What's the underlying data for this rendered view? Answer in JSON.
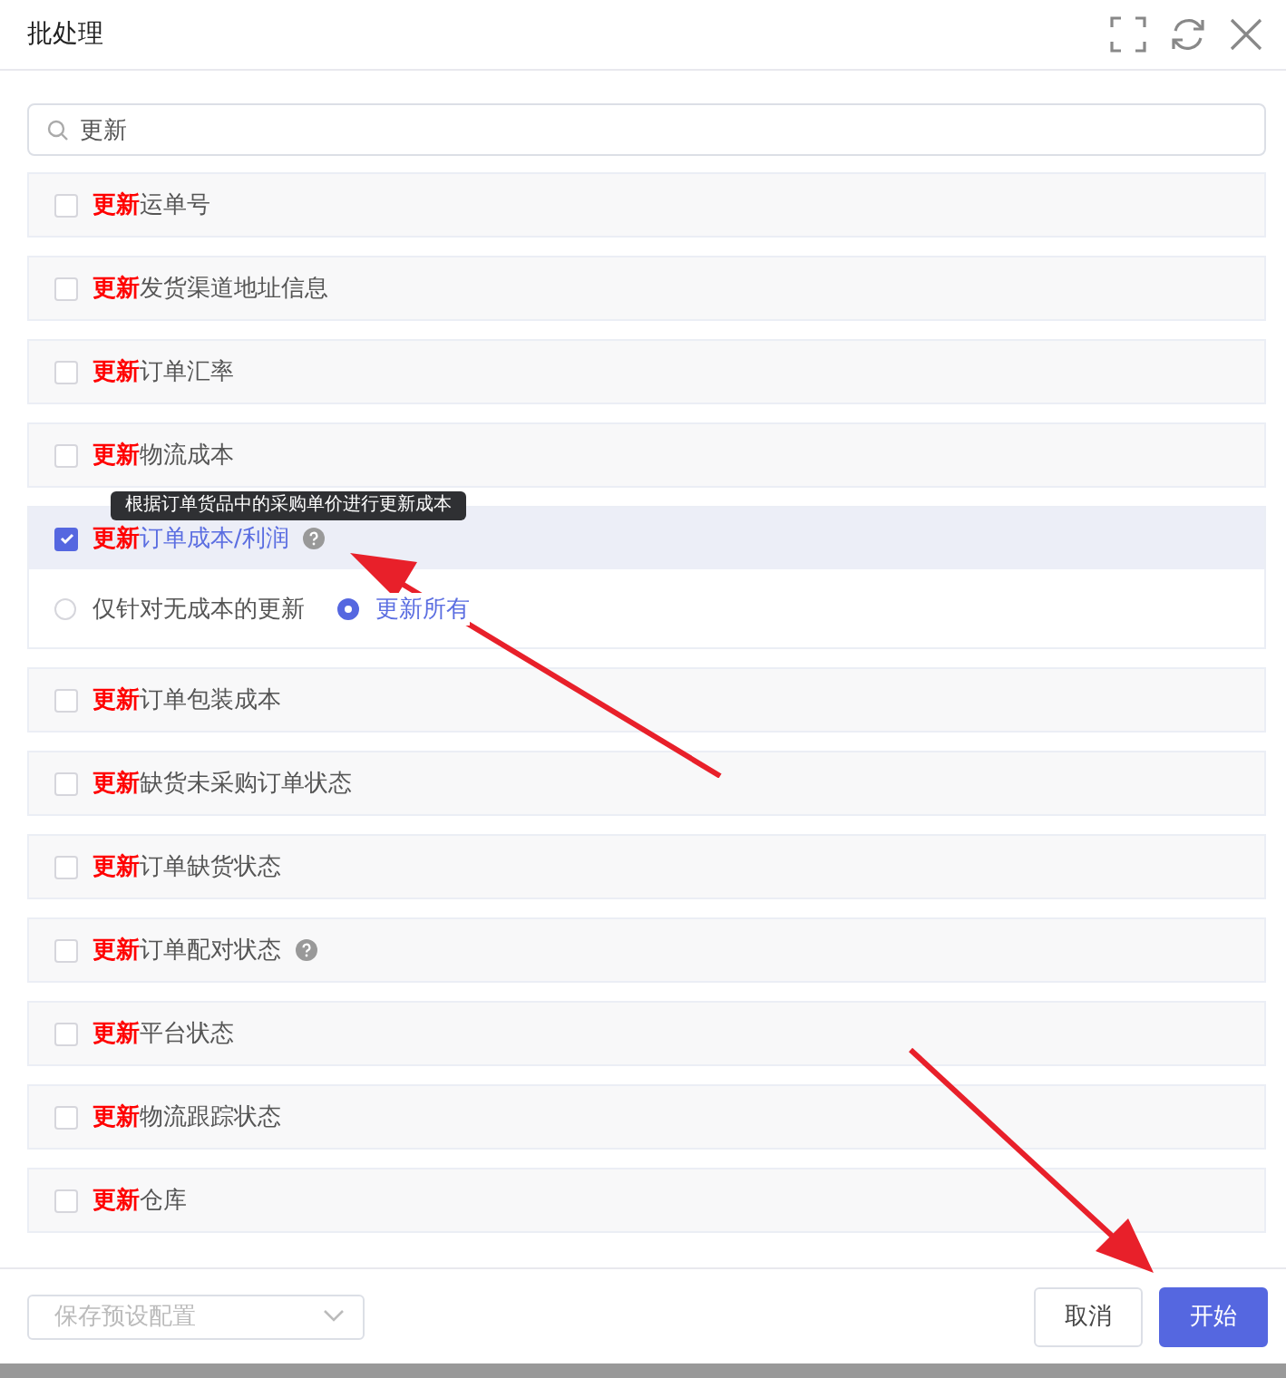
{
  "window": {
    "title": "批处理"
  },
  "search": {
    "value": "更新"
  },
  "items": [
    {
      "label": "**更新**运单号",
      "checked": false,
      "help": false
    },
    {
      "label": "**更新**发货渠道地址信息",
      "checked": false,
      "help": false
    },
    {
      "label": "**更新**订单汇率",
      "checked": false,
      "help": false
    },
    {
      "label": "**更新**物流成本",
      "checked": false,
      "help": false
    },
    {
      "label": "**更新**订单成本/利润",
      "checked": true,
      "help": true,
      "tooltip": "根据订单货品中的采购单价进行更新成本",
      "options": [
        {
          "label": "仅针对无成本的更新",
          "selected": false
        },
        {
          "label": "更新所有",
          "selected": true
        }
      ]
    },
    {
      "label": "**更新**订单包装成本",
      "checked": false,
      "help": false
    },
    {
      "label": "**更新**缺货未采购订单状态",
      "checked": false,
      "help": false
    },
    {
      "label": "**更新**订单缺货状态",
      "checked": false,
      "help": false
    },
    {
      "label": "**更新**订单配对状态",
      "checked": false,
      "help": true
    },
    {
      "label": "**更新**平台状态",
      "checked": false,
      "help": false
    },
    {
      "label": "**更新**物流跟踪状态",
      "checked": false,
      "help": false
    },
    {
      "label": "**更新**仓库",
      "checked": false,
      "help": false
    }
  ],
  "preset": {
    "placeholder": "保存预设配置"
  },
  "buttons": [
    {
      "label": "取消",
      "kind": "secondary"
    },
    {
      "label": "开始",
      "kind": "primary"
    }
  ]
}
